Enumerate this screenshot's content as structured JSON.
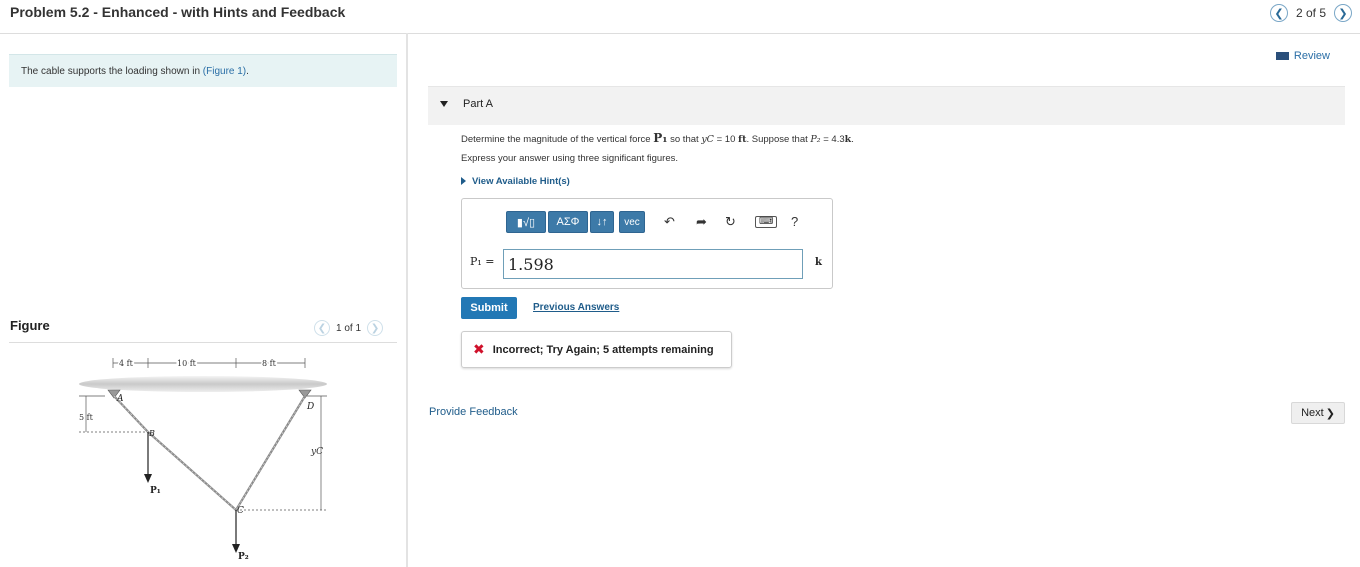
{
  "header": {
    "title": "Problem 5.2 - Enhanced - with Hints and Feedback",
    "pager_text": "2 of 5"
  },
  "intro": {
    "text": "The cable supports the loading shown in ",
    "link": "(Figure 1)",
    "suffix": "."
  },
  "figure": {
    "title": "Figure",
    "pager_text": "1 of 1",
    "labels": {
      "dim1": "4 ft",
      "dim2": "10 ft",
      "dim3": "8 ft",
      "dim_v": "5 ft",
      "A": "A",
      "B": "B",
      "C": "C",
      "D": "D",
      "yC": "yC",
      "P1": "P₁",
      "P2": "P₂"
    }
  },
  "review": {
    "label": "Review"
  },
  "part": {
    "label": "Part A",
    "question_pre": "Determine the magnitude of the vertical force ",
    "question_force": "P₁",
    "question_mid": " so that ",
    "question_var": "yC",
    "question_eq": " = 10 ",
    "question_unit": "ft",
    "question_suppose": ". Suppose that ",
    "question_p2": "P₂",
    "question_p2val": " = 4.3",
    "question_k": "k",
    "question_end": ".",
    "instruction": "Express your answer using three significant figures.",
    "hint_link": "View Available Hint(s)"
  },
  "toolbar": {
    "templates_label": "▮√▯",
    "greek_label": "ΑΣΦ",
    "arrows_label": "↓↑",
    "vec_label": "vec",
    "help_label": "?"
  },
  "answer": {
    "variable_label": "P₁ =",
    "value": "1.598",
    "unit": "k"
  },
  "actions": {
    "submit_label": "Submit",
    "previous_answers": "Previous Answers"
  },
  "feedback": {
    "message": "Incorrect; Try Again; 5 attempts remaining"
  },
  "footer": {
    "provide_feedback": "Provide Feedback",
    "next_label": "Next"
  },
  "colors": {
    "accent": "#2278b5",
    "toolbar_button": "#3d7aa8",
    "error": "#d0112b",
    "intro_background": "#e7f3f4"
  }
}
